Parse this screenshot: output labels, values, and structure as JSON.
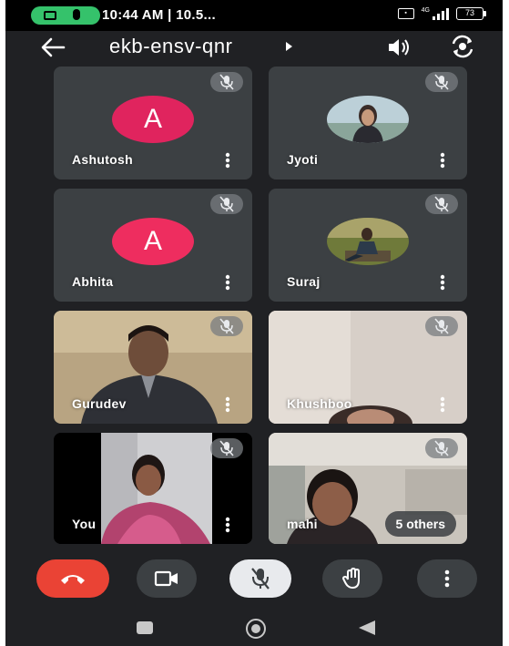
{
  "status_bar": {
    "time": "10:44 AM | 10.5...",
    "network": "4G",
    "battery": "73",
    "icons": [
      "screen-record-camera-icon",
      "screen-record-mic-icon",
      "volte-icon",
      "signal-icon",
      "battery-icon"
    ]
  },
  "header": {
    "meeting_code": "ekb-ensv-qnr",
    "icons": [
      "back-arrow-icon",
      "meeting-details-caret-icon",
      "speaker-icon",
      "switch-camera-icon"
    ]
  },
  "participants": [
    {
      "name": "Ashutosh",
      "avatar_letter": "A",
      "avatar_color": "#e0245e",
      "video": false,
      "muted": true
    },
    {
      "name": "Jyoti",
      "avatar_photo": true,
      "video": false,
      "muted": true
    },
    {
      "name": "Abhita",
      "avatar_letter": "A",
      "avatar_color": "#ee2d5f",
      "video": false,
      "muted": true
    },
    {
      "name": "Suraj",
      "avatar_photo": true,
      "video": false,
      "muted": true
    },
    {
      "name": "Gurudev",
      "video": true,
      "muted": true
    },
    {
      "name": "Khushboo",
      "video": true,
      "muted": true
    },
    {
      "name": "You",
      "video": true,
      "muted": true
    },
    {
      "name": "mahi",
      "video": true,
      "muted": true,
      "overflow_label": "5 others"
    }
  ],
  "controls": {
    "icons": [
      "end-call-icon",
      "camera-icon",
      "mic-off-icon",
      "raise-hand-icon",
      "more-vert-icon"
    ],
    "colors": {
      "end_call": "#ea4335",
      "mic_active_bg": "#e8eaed",
      "button_bg": "#3c4043"
    }
  },
  "nav_bar": {
    "icons": [
      "recents-icon",
      "home-icon",
      "back-icon"
    ]
  },
  "colors": {
    "background": "#202124",
    "tile": "#3c4043",
    "status_bar": "#000000",
    "recording_pill": "#35c26b"
  }
}
